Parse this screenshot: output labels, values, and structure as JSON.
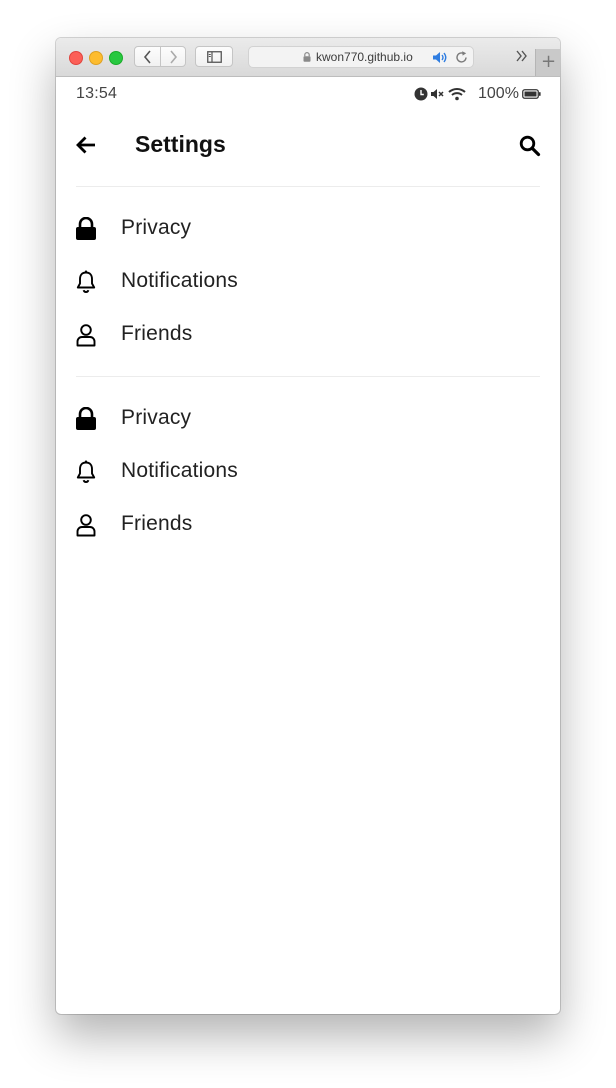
{
  "browser": {
    "url": "kwon770.github.io",
    "new_tab": "+"
  },
  "status_bar": {
    "time": "13:54",
    "battery": "100%"
  },
  "header": {
    "title": "Settings"
  },
  "groups": [
    {
      "items": [
        {
          "label": "Privacy",
          "icon": "lock-icon"
        },
        {
          "label": "Notifications",
          "icon": "bell-icon"
        },
        {
          "label": "Friends",
          "icon": "person-icon"
        }
      ]
    },
    {
      "items": [
        {
          "label": "Privacy",
          "icon": "lock-icon"
        },
        {
          "label": "Notifications",
          "icon": "bell-icon"
        },
        {
          "label": "Friends",
          "icon": "person-icon"
        }
      ]
    }
  ]
}
